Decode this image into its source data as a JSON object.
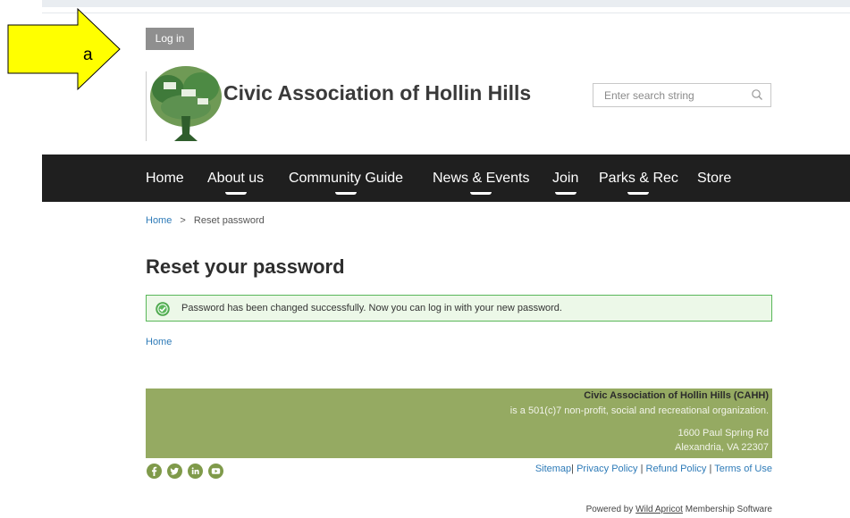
{
  "callout": {
    "letter": "a",
    "fill_color": "#ffff00"
  },
  "header": {
    "login_label": "Log in",
    "site_title": "Civic Association of Hollin Hills",
    "search_placeholder": "Enter search string"
  },
  "nav": {
    "items": [
      {
        "label": "Home"
      },
      {
        "label": "About us"
      },
      {
        "label": "Community Guide"
      },
      {
        "label": "News & Events"
      },
      {
        "label": "Join"
      },
      {
        "label": "Parks & Rec"
      },
      {
        "label": "Store"
      }
    ]
  },
  "breadcrumb": {
    "home": "Home",
    "separator": ">",
    "current": "Reset password"
  },
  "main": {
    "title": "Reset your password",
    "success_message": "Password has been changed successfully. Now you can log in with your new password.",
    "home_link": "Home"
  },
  "footer": {
    "org_name": "Civic Association of Hollin Hills (CAHH)",
    "org_desc": "is a 501(c)7 non-profit, social and recreational organization.",
    "address_line1": "1600 Paul Spring Rd",
    "address_line2": "Alexandria, VA 22307",
    "links": {
      "sitemap": "Sitemap",
      "privacy": "Privacy Policy",
      "refund": "Refund Policy",
      "terms": "Terms of Use",
      "separator": "|"
    },
    "powered_prefix": "Powered by",
    "powered_brand": "Wild Apricot",
    "powered_suffix": "Membership Software",
    "social_icons": [
      "facebook-icon",
      "twitter-icon",
      "linkedin-icon",
      "youtube-icon"
    ],
    "box_color": "#95aa62",
    "icon_color": "#7f9a4a"
  },
  "colors": {
    "nav_bg": "#1f1f1f",
    "link": "#2e7bb8",
    "success_border": "#59b759",
    "success_bg": "#ecf8e8",
    "login_bg": "#8f8f8f"
  }
}
